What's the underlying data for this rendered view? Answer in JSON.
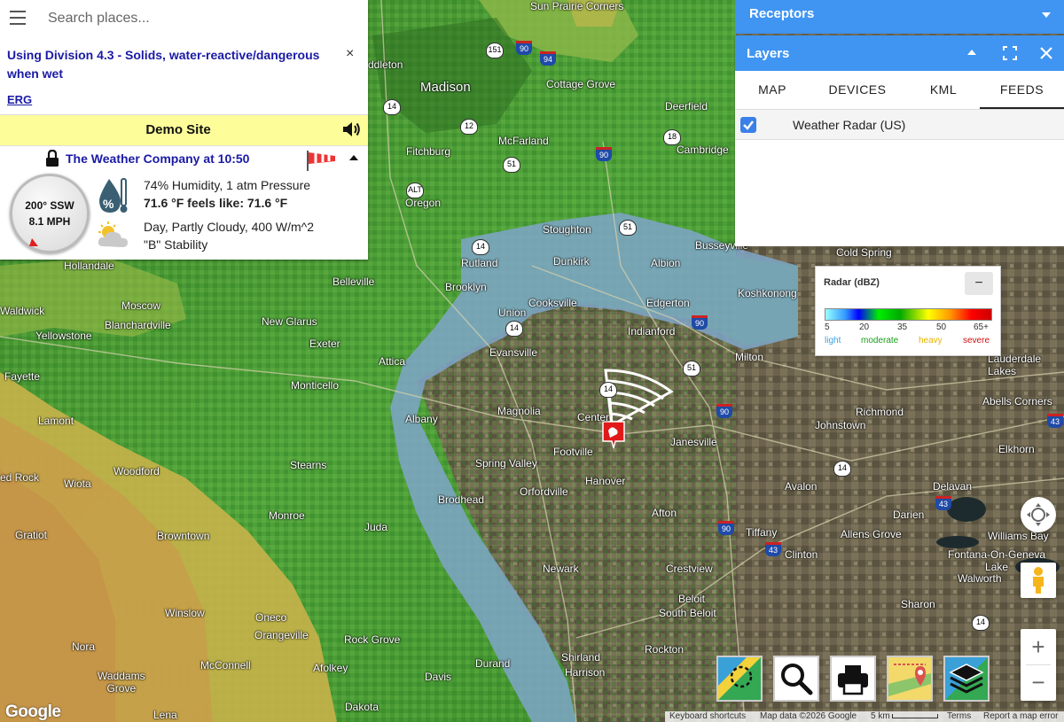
{
  "search": {
    "placeholder": "Search places..."
  },
  "material": {
    "title": "Using Division 4.3 - Solids, water-reactive/dangerous when wet",
    "close_glyph": "×",
    "erg_label": "ERG"
  },
  "site": {
    "name": "Demo Site"
  },
  "weather": {
    "source": "The Weather Company at 10:50",
    "wind_direction": "200° SSW",
    "wind_speed": "8.1 MPH",
    "line1": "74% Humidity, 1 atm Pressure",
    "line2": "71.6 °F feels like: 71.6 °F",
    "line3": "Day, Partly Cloudy, 400 W/m^2",
    "line4": "\"B\" Stability"
  },
  "receptors": {
    "title": "Receptors"
  },
  "layers": {
    "title": "Layers",
    "tabs": [
      "MAP",
      "DEVICES",
      "KML",
      "FEEDS"
    ],
    "active_tab": "FEEDS",
    "feeds": [
      {
        "label": "Weather Radar (US)",
        "checked": true
      }
    ]
  },
  "legend": {
    "title": "Radar (dBZ)",
    "minimize_glyph": "−",
    "ticks": [
      "5",
      "20",
      "35",
      "50",
      "65+"
    ],
    "categories": [
      {
        "label": "light",
        "color": "#39a0e8"
      },
      {
        "label": "moderate",
        "color": "#1a9e1a"
      },
      {
        "label": "heavy",
        "color": "#e6b400"
      },
      {
        "label": "severe",
        "color": "#d01010"
      }
    ]
  },
  "zoom": {
    "in": "+",
    "out": "−"
  },
  "map": {
    "places": {
      "madison": "Madison",
      "cottage_grove": "Cottage Grove",
      "deerfield": "Deerfield",
      "mcfarland": "McFarland",
      "cambridge": "Cambridge",
      "fitchburg": "Fitchburg",
      "oregon": "Oregon",
      "stoughton": "Stoughton",
      "busseyville": "Busseyville",
      "cold_spring": "Cold Spring",
      "dunkirk": "Dunkirk",
      "albion": "Albion",
      "koshkonong": "Koshkonong",
      "hollandale": "Hollandale",
      "belleville": "Belleville",
      "rutland": "Rutland",
      "brooklyn": "Brooklyn",
      "union": "Union",
      "cooksville": "Cooksville",
      "edgerton": "Edgerton",
      "indianford": "Indianford",
      "moscow": "Moscow",
      "blanchardville": "Blanchardville",
      "new_glarus": "New Glarus",
      "waldwick": "Waldwick",
      "yellowstone": "Yellowstone",
      "exeter": "Exeter",
      "evansville": "Evansville",
      "milton": "Milton",
      "lauderdale_lakes": "Lauderdale\nLakes",
      "fayette": "Fayette",
      "attica": "Attica",
      "monticello": "Monticello",
      "magnolia": "Magnolia",
      "center": "Center",
      "janesville": "Janesville",
      "richmond": "Richmond",
      "abells_corners": "Abells Corners",
      "lamont": "Lamont",
      "albany": "Albany",
      "johnstown": "Johnstown",
      "footville": "Footville",
      "elkhorn": "Elkhorn",
      "spring_valley": "Spring Valley",
      "stearns": "Stearns",
      "red_rock": "ed Rock",
      "wiota": "Wiota",
      "woodford": "Woodford",
      "hanover": "Hanover",
      "avalon": "Avalon",
      "delavan": "Delavan",
      "orfordville": "Orfordville",
      "afton": "Afton",
      "darien": "Darien",
      "brodhead": "Brodhead",
      "gratiot": "Gratiot",
      "monroe": "Monroe",
      "juda": "Juda",
      "tiffany": "Tiffany",
      "allens_grove": "Allens Grove",
      "williams_bay": "Williams Bay",
      "browntown": "Browntown",
      "clinton": "Clinton",
      "fontana": "Fontana-On-Geneva\nLake",
      "newark": "Newark",
      "crestview": "Crestview",
      "walworth": "Walworth",
      "beloit": "Beloit",
      "sharon": "Sharon",
      "south_beloit": "South Beloit",
      "winslow": "Winslow",
      "oneco": "Oneco",
      "orangeville": "Orangeville",
      "nora": "Nora",
      "rock_grove": "Rock Grove",
      "rockton": "Rockton",
      "mcconnell": "McConnell",
      "shirland": "Shirland",
      "afolkey": "Afolkey",
      "durand": "Durand",
      "harrison": "Harrison",
      "waddams_grove": "Waddams\nGrove",
      "davis": "Davis",
      "lena": "Lena",
      "dakota": "Dakota",
      "middleton": "ddleton",
      "sun_prairie_corners": "Sun Prairie Corners"
    }
  },
  "footer": {
    "google": "Google",
    "shortcuts": "Keyboard shortcuts",
    "mapdata": "Map data ©2026 Google",
    "scale": "5 km",
    "terms": "Terms",
    "report": "Report a map error"
  }
}
